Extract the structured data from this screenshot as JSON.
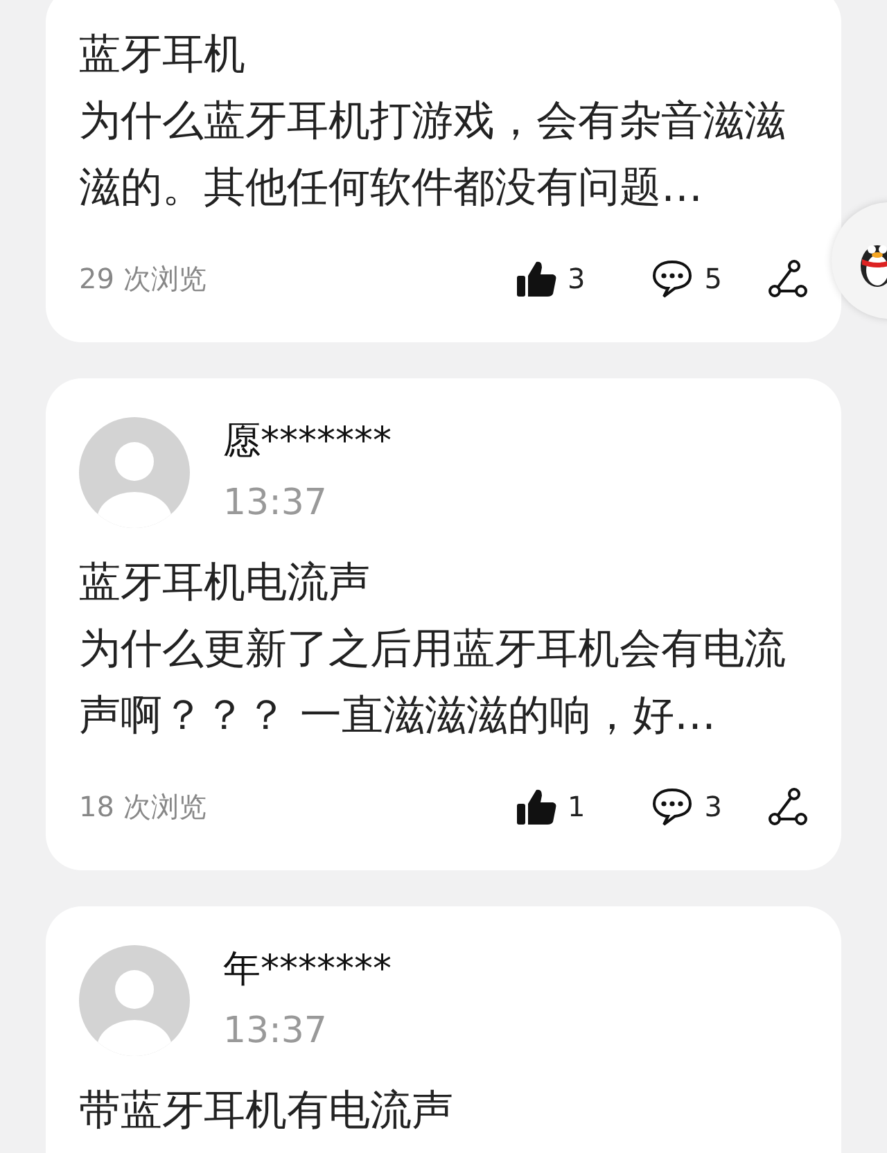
{
  "posts": [
    {
      "title": "蓝牙耳机",
      "body": "为什么蓝牙耳机打游戏，会有杂音滋滋滋的。其他任何软件都没有问题…",
      "views": "29 次浏览",
      "likes": "3",
      "comments": "5"
    },
    {
      "author": "愿*******",
      "time": "13:37",
      "title": "蓝牙耳机电流声",
      "body": "为什么更新了之后用蓝牙耳机会有电流声啊？？？ 一直滋滋滋的响，好…",
      "views": "18 次浏览",
      "likes": "1",
      "comments": "3"
    },
    {
      "author": "年*******",
      "time": "13:37",
      "title": "带蓝牙耳机有电流声"
    }
  ]
}
